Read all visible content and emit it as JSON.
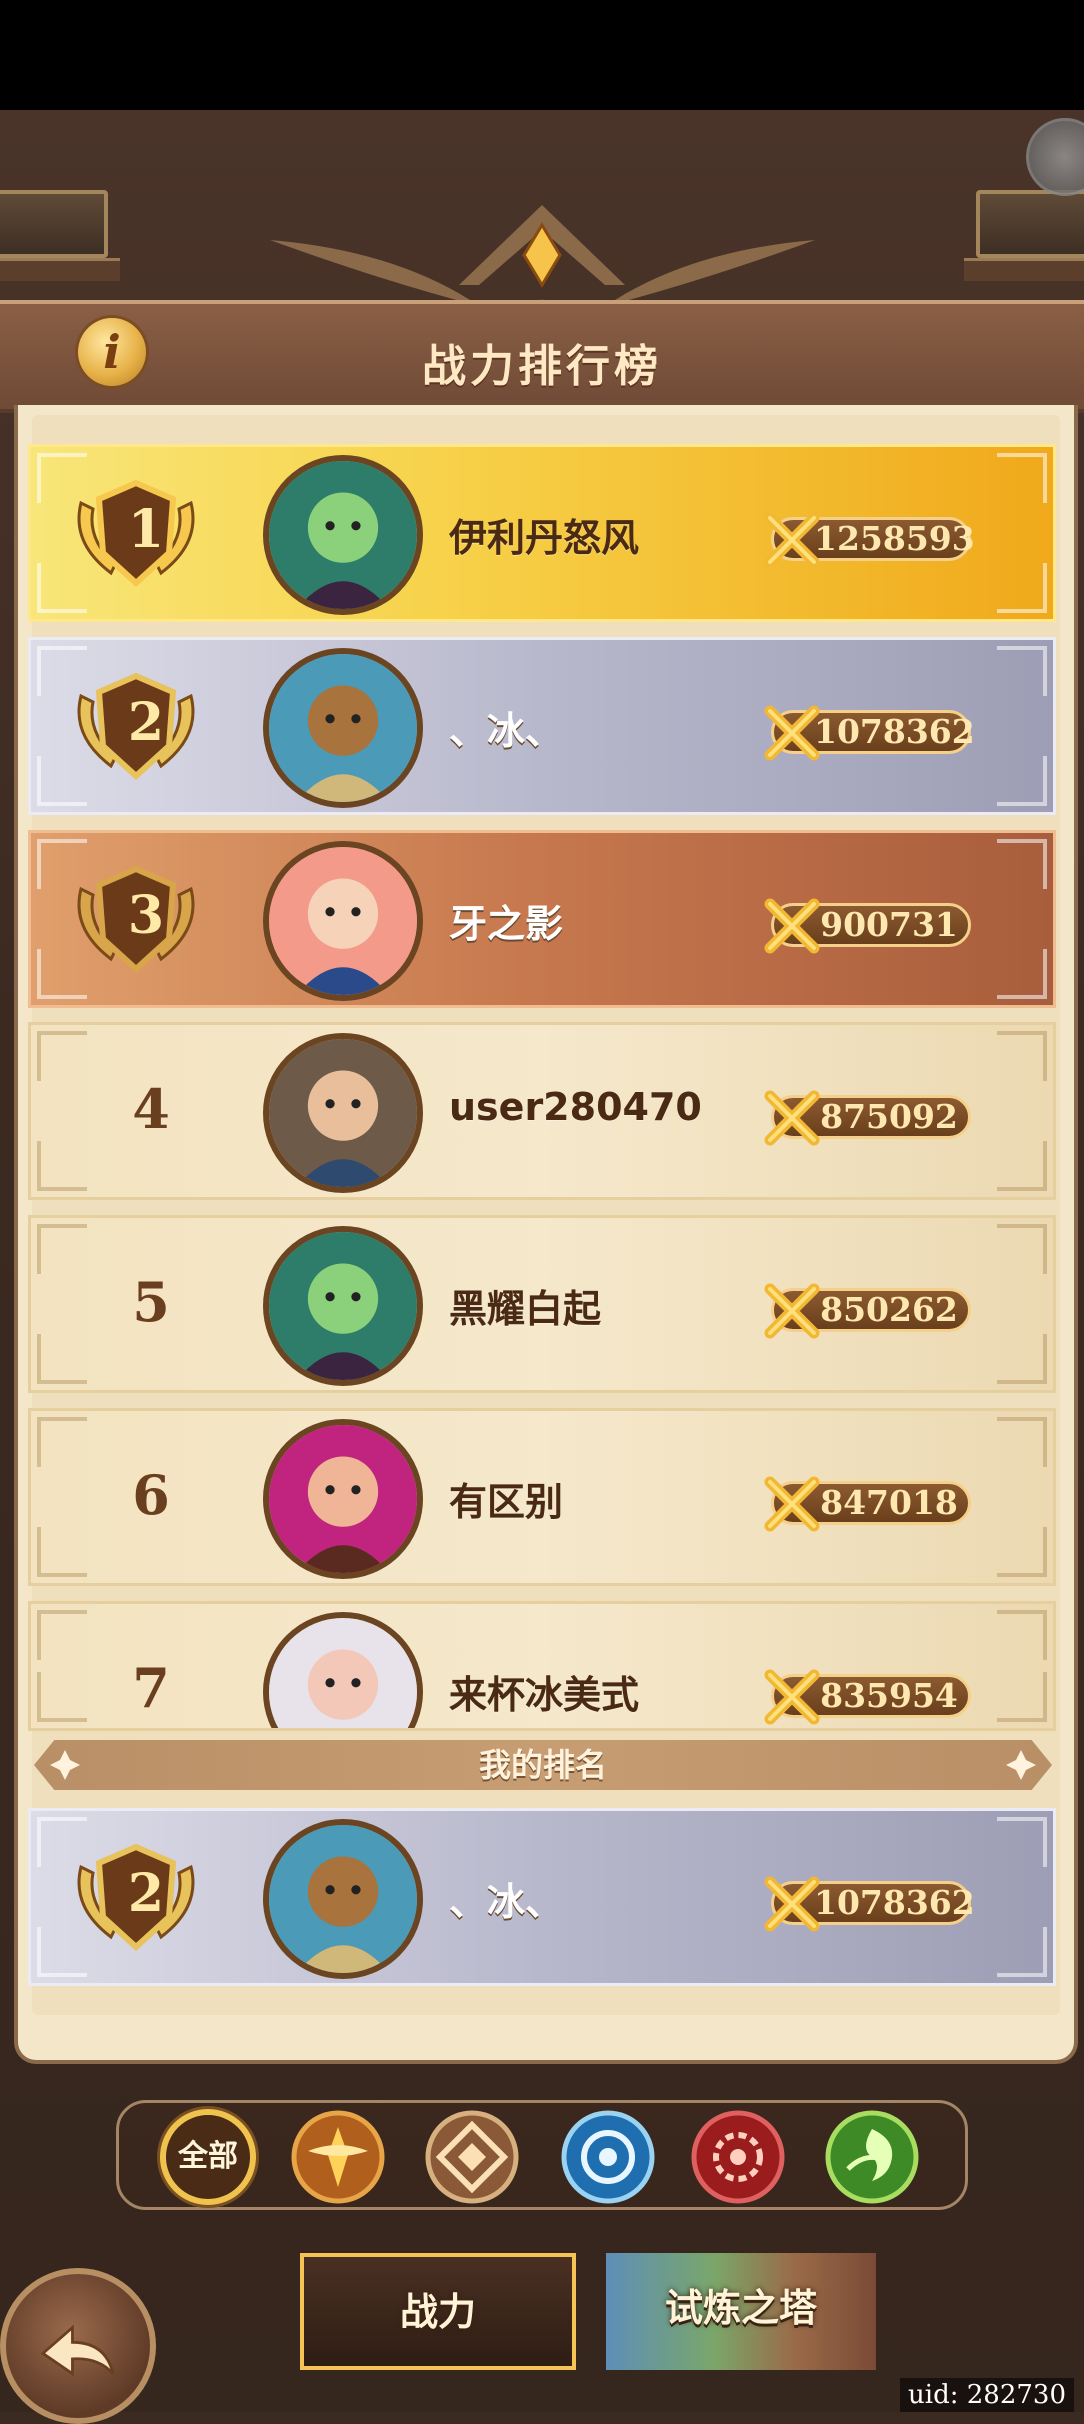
{
  "header": {
    "title": "战力排行榜",
    "info_icon": "info-icon"
  },
  "rankings": [
    {
      "rank": "1",
      "name": "伊利丹怒风",
      "power": "1258593",
      "style": "gold"
    },
    {
      "rank": "2",
      "name": "、冰、",
      "power": "1078362",
      "style": "silver"
    },
    {
      "rank": "3",
      "name": "牙之影",
      "power": "900731",
      "style": "bronze"
    },
    {
      "rank": "4",
      "name": "user280470",
      "power": "875092",
      "style": "plain"
    },
    {
      "rank": "5",
      "name": "黑耀白起",
      "power": "850262",
      "style": "plain"
    },
    {
      "rank": "6",
      "name": "有区别",
      "power": "847018",
      "style": "plain"
    },
    {
      "rank": "7",
      "name": "来杯冰美式",
      "power": "835954",
      "style": "plain"
    }
  ],
  "my_rank": {
    "label": "我的排名",
    "rank": "2",
    "name": "、冰、",
    "power": "1078362"
  },
  "filters": [
    {
      "label": "全部",
      "icon": "all-factions",
      "active": true
    },
    {
      "icon": "lightbearer-icon"
    },
    {
      "icon": "mauler-icon"
    },
    {
      "icon": "wilder-icon"
    },
    {
      "icon": "graveborn-icon"
    },
    {
      "icon": "celestial-icon"
    }
  ],
  "tabs": [
    {
      "label": "战力",
      "active": true
    },
    {
      "label": "试炼之塔",
      "active": false
    }
  ],
  "footer": {
    "uid": "uid: 282730"
  },
  "colors": {
    "gold": "#f7d24a",
    "silver": "#b8b8cc",
    "bronze": "#c6774d",
    "plain": "#f5e8cb",
    "accent": "#f0c24e"
  }
}
